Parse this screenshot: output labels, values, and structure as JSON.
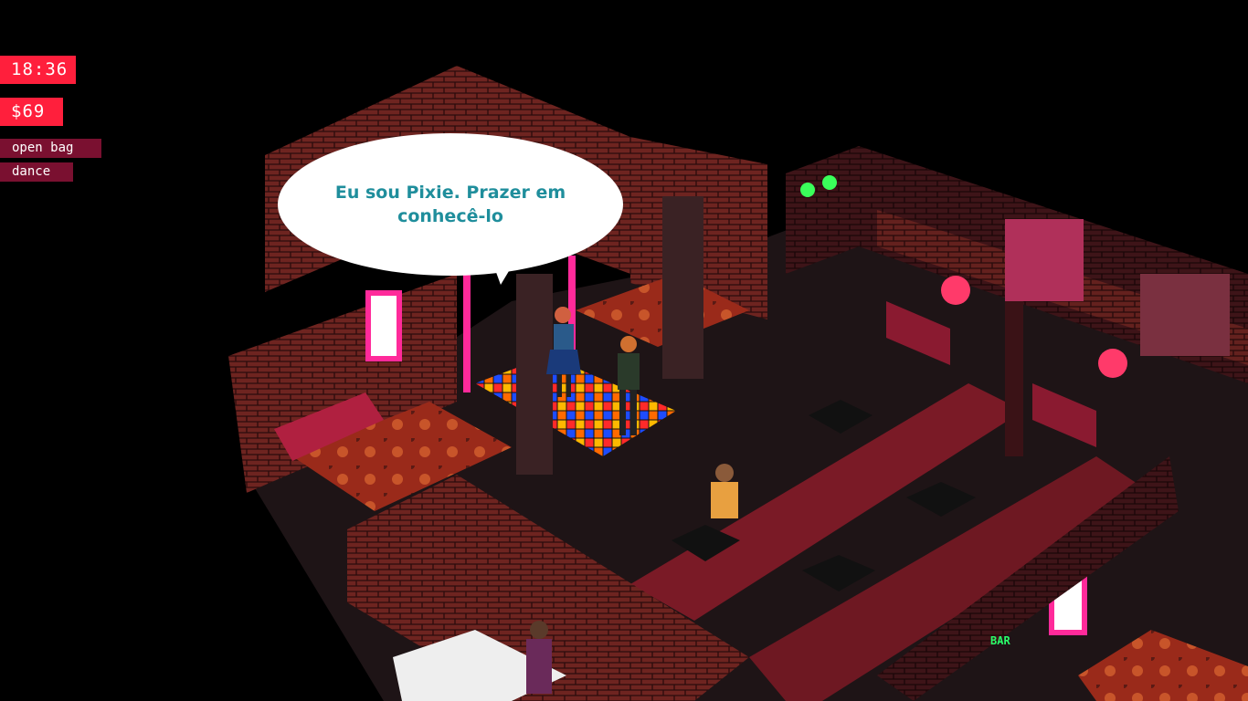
{
  "hud": {
    "clock": "18:36",
    "money": "$69",
    "open_bag_label": "open bag",
    "dance_label": "dance"
  },
  "dialogue": {
    "speech": "Eu sou Pixie. Prazer em conhecê-lo"
  },
  "scene": {
    "sign_text": "BAR",
    "accent_color": "#ff1f3c",
    "button_color": "#7a1030",
    "speech_color": "#1f8e9c"
  }
}
